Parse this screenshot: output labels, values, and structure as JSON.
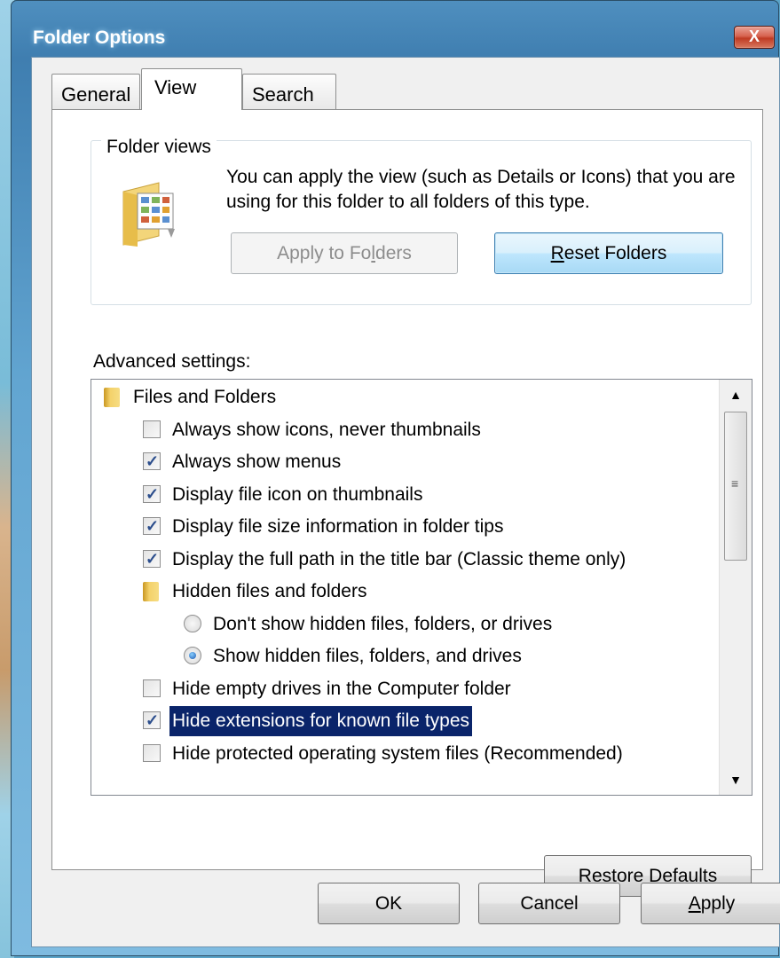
{
  "window": {
    "title": "Folder Options",
    "close_glyph": "X"
  },
  "tabs": [
    {
      "label": "General",
      "selected": false
    },
    {
      "label": "View",
      "selected": true
    },
    {
      "label": "Search",
      "selected": false
    }
  ],
  "folder_views": {
    "group_label": "Folder views",
    "description": "You can apply the view (such as Details or Icons) that you are using for this folder to all folders of this type.",
    "apply_button": {
      "pre": "Apply to Fo",
      "mnemonic": "l",
      "post": "ders",
      "enabled": false
    },
    "reset_button": {
      "pre": "",
      "mnemonic": "R",
      "post": "eset Folders",
      "enabled": true
    },
    "icon": "folder-view-icon"
  },
  "advanced": {
    "label": "Advanced settings:",
    "items": [
      {
        "type": "folder",
        "label": "Files and Folders",
        "indent": 0
      },
      {
        "type": "checkbox",
        "label": "Always show icons, never thumbnails",
        "checked": false,
        "indent": 1
      },
      {
        "type": "checkbox",
        "label": "Always show menus",
        "checked": true,
        "indent": 1
      },
      {
        "type": "checkbox",
        "label": "Display file icon on thumbnails",
        "checked": true,
        "indent": 1
      },
      {
        "type": "checkbox",
        "label": "Display file size information in folder tips",
        "checked": true,
        "indent": 1
      },
      {
        "type": "checkbox",
        "label": "Display the full path in the title bar (Classic theme only)",
        "checked": true,
        "indent": 1
      },
      {
        "type": "folder",
        "label": "Hidden files and folders",
        "indent": 1
      },
      {
        "type": "radio",
        "label": "Don't show hidden files, folders, or drives",
        "selected": false,
        "indent": 2
      },
      {
        "type": "radio",
        "label": "Show hidden files, folders, and drives",
        "selected": true,
        "indent": 2
      },
      {
        "type": "checkbox",
        "label": "Hide empty drives in the Computer folder",
        "checked": false,
        "indent": 1
      },
      {
        "type": "checkbox",
        "label": "Hide extensions for known file types",
        "checked": true,
        "indent": 1,
        "highlighted": true
      },
      {
        "type": "checkbox",
        "label": "Hide protected operating system files (Recommended)",
        "checked": false,
        "indent": 1
      }
    ],
    "scroll_position": 0
  },
  "buttons": {
    "restore_defaults": {
      "pre": "Restore ",
      "mnemonic": "D",
      "post": "efaults"
    },
    "ok": {
      "label": "OK"
    },
    "cancel": {
      "label": "Cancel"
    },
    "apply": {
      "pre": "",
      "mnemonic": "A",
      "post": "pply"
    }
  },
  "colors": {
    "selection": "#0a246a",
    "title_text": "#ffffff",
    "close_button": "#c0392b"
  }
}
